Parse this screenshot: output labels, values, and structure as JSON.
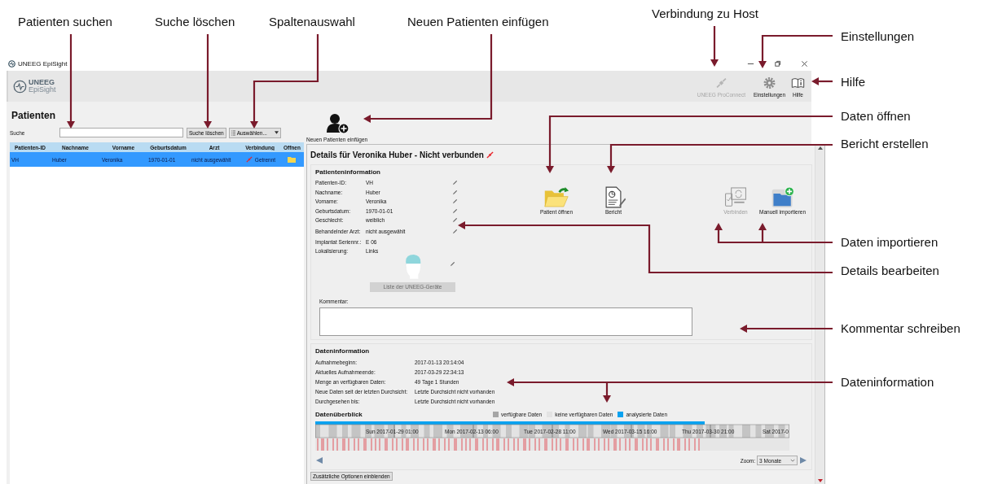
{
  "annotations": [
    {
      "label": "Patienten suchen"
    },
    {
      "label": "Suche löschen"
    },
    {
      "label": "Spaltenauswahl"
    },
    {
      "label": "Neuen Patienten einfügen"
    },
    {
      "label": "Verbindung zu Host"
    },
    {
      "label": "Einstellungen"
    },
    {
      "label": "Hilfe"
    },
    {
      "label": "Daten öffnen"
    },
    {
      "label": "Bericht erstellen"
    },
    {
      "label": "Daten importieren"
    },
    {
      "label": "Details bearbeiten"
    },
    {
      "label": "Kommentar schreiben"
    },
    {
      "label": "Dateninformation"
    }
  ],
  "window": {
    "title": "UNEEG EpiSight"
  },
  "toolbar": {
    "logo": {
      "brand": "UNEEG",
      "product": "EpiSight"
    },
    "buttons": [
      {
        "label": "UNEEG ProConnect",
        "kind": "connect",
        "disabled": true
      },
      {
        "label": "Einstellungen",
        "kind": "settings",
        "disabled": false
      },
      {
        "label": "Hilfe",
        "kind": "help",
        "disabled": false
      }
    ]
  },
  "patients": {
    "title": "Patienten",
    "search_label": "Suche",
    "clear_button": "Suche löschen",
    "column_select": "Auswählen...",
    "table": {
      "columns": [
        "Patienten-ID",
        "Nachname",
        "Vorname",
        "Geburtsdatum",
        "Arzt",
        "Verbindung",
        "Öffnen"
      ],
      "rows": [
        {
          "cells": [
            "VH",
            "Huber",
            "Veronika",
            "1970-01-01",
            "nicht ausgewählt"
          ],
          "connection": "Getrennt",
          "selected": true
        }
      ]
    }
  },
  "new_patient": {
    "label": "Neuen Patienten einfügen"
  },
  "details": {
    "title": "Details für Veronika Huber - Nicht verbunden",
    "patient_info": {
      "title": "Patienteninformation",
      "fields": [
        {
          "label": "Patienten-ID:",
          "value": "VH",
          "editable": true
        },
        {
          "label": "Nachname:",
          "value": "Huber",
          "editable": true
        },
        {
          "label": "Vorname:",
          "value": "Veronika",
          "editable": true
        },
        {
          "label": "Geburtsdatum:",
          "value": "1970-01-01",
          "editable": true
        },
        {
          "label": "Geschlecht:",
          "value": "weiblich",
          "editable": true
        },
        {
          "label": "Behandelnder Arzt:",
          "value": "nicht ausgewählt",
          "editable": true
        },
        {
          "label": "Implantat Seriennr.:",
          "value": "E 06",
          "editable": false
        },
        {
          "label": "Lokalisierung:",
          "value": "Links",
          "editable": false
        }
      ],
      "localization_editable": true,
      "devices_button": {
        "label": "Liste der UNEEG-Geräte",
        "disabled": true
      }
    },
    "actions": [
      {
        "label": "Patient öffnen",
        "kind": "open",
        "disabled": false
      },
      {
        "label": "Bericht",
        "kind": "report",
        "disabled": false
      },
      {
        "label": "Verbinden",
        "kind": "connect",
        "disabled": true
      },
      {
        "label": "Manuell importieren",
        "kind": "import",
        "disabled": false
      }
    ],
    "comment": {
      "label": "Kommentar:"
    },
    "data_info": {
      "title": "Dateninformation",
      "rows": [
        {
          "label": "Aufnahmebeginn:",
          "value": "2017-01-13 20:14:04"
        },
        {
          "label": "Aktuelles Aufnahmeende:",
          "value": "2017-03-29 22:34:13"
        },
        {
          "label": "Menge an verfügbaren Daten:",
          "value": "49 Tage 1 Stunden"
        },
        {
          "label": "Neue Daten seit der letzten Durchsicht:",
          "value": "Letzte Durchsicht nicht vorhanden"
        },
        {
          "label": "Durchgesehen bis:",
          "value": "Letzte Durchsicht nicht vorhanden"
        }
      ]
    },
    "overview": {
      "title": "Datenüberblick",
      "legend": [
        {
          "label": "verfügbare Daten",
          "color": "#a6a6a6"
        },
        {
          "label": "keine verfügbaren Daten",
          "color": "#e3e3e3"
        },
        {
          "label": "analysierte Daten",
          "color": "#0aa2f0"
        }
      ],
      "timeline_labels": [
        "Sun 2017-01-29 01:00",
        "Mon 2017-02-13 06:00",
        "Tue 2017-02-28 11:00",
        "Wed 2017-03-15 16:00",
        "Thu 2017-03-30 21:00",
        "Sat 2017-0"
      ],
      "zoom": {
        "label": "Zoom:",
        "value": "3 Monate"
      }
    },
    "more_options_button": "Zusätzliche Optionen einblenden"
  }
}
